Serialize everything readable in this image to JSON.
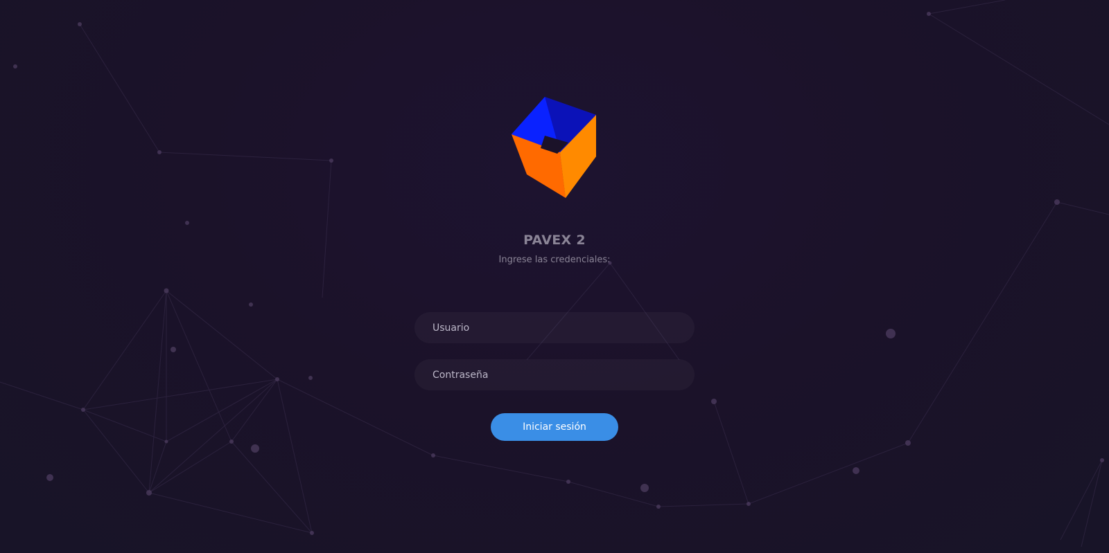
{
  "app": {
    "title": "PAVEX 2",
    "subtitle": "Ingrese las credenciales:"
  },
  "form": {
    "username_placeholder": "Usuario",
    "username_value": "",
    "password_placeholder": "Contraseña",
    "password_value": "",
    "submit_label": "Iniciar sesión"
  },
  "colors": {
    "background": "#1b1229",
    "accent": "#3a8ee6",
    "logo_blue": "#0a1cff",
    "logo_orange": "#ff7a00"
  },
  "icons": {
    "logo": "cube-logo-icon"
  }
}
